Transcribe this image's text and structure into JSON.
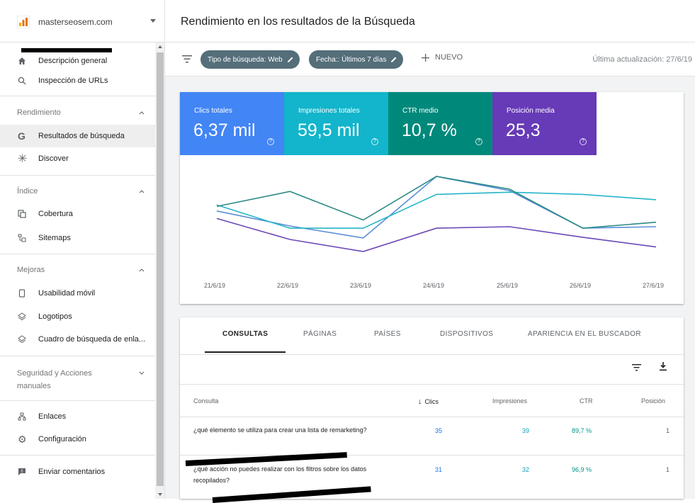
{
  "property": {
    "name": "masterseosem.com"
  },
  "sidebar": {
    "overview": {
      "label": "Descripción general"
    },
    "url_inspection": {
      "label": "Inspección de URLs"
    },
    "sections": [
      {
        "title": "Rendimiento",
        "items": [
          {
            "label": "Resultados de búsqueda",
            "icon": "google-g-icon"
          },
          {
            "label": "Discover",
            "icon": "asterisk-icon"
          }
        ]
      },
      {
        "title": "Índice",
        "items": [
          {
            "label": "Cobertura",
            "icon": "copy-icon"
          },
          {
            "label": "Sitemaps",
            "icon": "sitemap-icon"
          }
        ]
      },
      {
        "title": "Mejoras",
        "items": [
          {
            "label": "Usabilidad móvil",
            "icon": "phone-icon"
          },
          {
            "label": "Logotipos",
            "icon": "layers-icon"
          },
          {
            "label": "Cuadro de búsqueda de enla...",
            "icon": "layers-icon"
          }
        ]
      },
      {
        "title": "Seguridad y Acciones manuales"
      }
    ],
    "links": {
      "label": "Enlaces"
    },
    "settings": {
      "label": "Configuración"
    },
    "feedback": {
      "label": "Enviar comentarios"
    }
  },
  "header": {
    "title": "Rendimiento en los resultados de la Búsqueda"
  },
  "filters": {
    "search_type": "Tipo de búsqueda: Web",
    "date": "Fecha:: Últimos 7 días",
    "new_label": "NUEVO",
    "last_update": "Última actualización: 27/6/19"
  },
  "metrics": [
    {
      "label": "Clics totales",
      "value": "6,37 mil",
      "color": "#4285f4"
    },
    {
      "label": "Impresiones totales",
      "value": "59,5 mil",
      "color": "#12b5cb"
    },
    {
      "label": "CTR medio",
      "value": "10,7 %",
      "color": "#00897b"
    },
    {
      "label": "Posición media",
      "value": "25,3",
      "color": "#673ab7"
    }
  ],
  "chart_data": {
    "type": "line",
    "x": [
      "21/6/19",
      "22/6/19",
      "23/6/19",
      "24/6/19",
      "25/6/19",
      "26/6/19",
      "27/6/19"
    ],
    "series": [
      {
        "name": "Clics totales",
        "color": "#5a8fd8",
        "values": [
          0.54,
          0.34,
          0.18,
          1.0,
          0.81,
          0.31,
          0.33
        ]
      },
      {
        "name": "Impresiones totales",
        "color": "#26b5c9",
        "values": [
          0.62,
          0.31,
          0.31,
          0.76,
          0.79,
          0.76,
          0.69
        ]
      },
      {
        "name": "CTR medio",
        "color": "#2b8a84",
        "values": [
          0.6,
          0.8,
          0.42,
          1.0,
          0.83,
          0.31,
          0.39
        ]
      },
      {
        "name": "Posición media",
        "color": "#6c49b8",
        "values": [
          0.44,
          0.16,
          0.0,
          0.31,
          0.33,
          0.19,
          0.06
        ]
      }
    ]
  },
  "table": {
    "tabs": [
      "CONSULTAS",
      "PÁGINAS",
      "PAÍSES",
      "DISPOSITIVOS",
      "APARIENCIA EN EL BUSCADOR"
    ],
    "headers": {
      "query": "Consulta",
      "clicks": "Clics",
      "impressions": "Impresiones",
      "ctr": "CTR",
      "position": "Posición"
    },
    "rows": [
      {
        "query": "¿qué elemento se utiliza para crear una lista de remarketing?",
        "clicks": "35",
        "impressions": "39",
        "ctr": "89,7 %",
        "position": "1"
      },
      {
        "query": "¿qué acción no puedes realizar con los filtros sobre los datos recopilados?",
        "clicks": "31",
        "impressions": "32",
        "ctr": "96,9 %",
        "position": "1"
      }
    ]
  }
}
